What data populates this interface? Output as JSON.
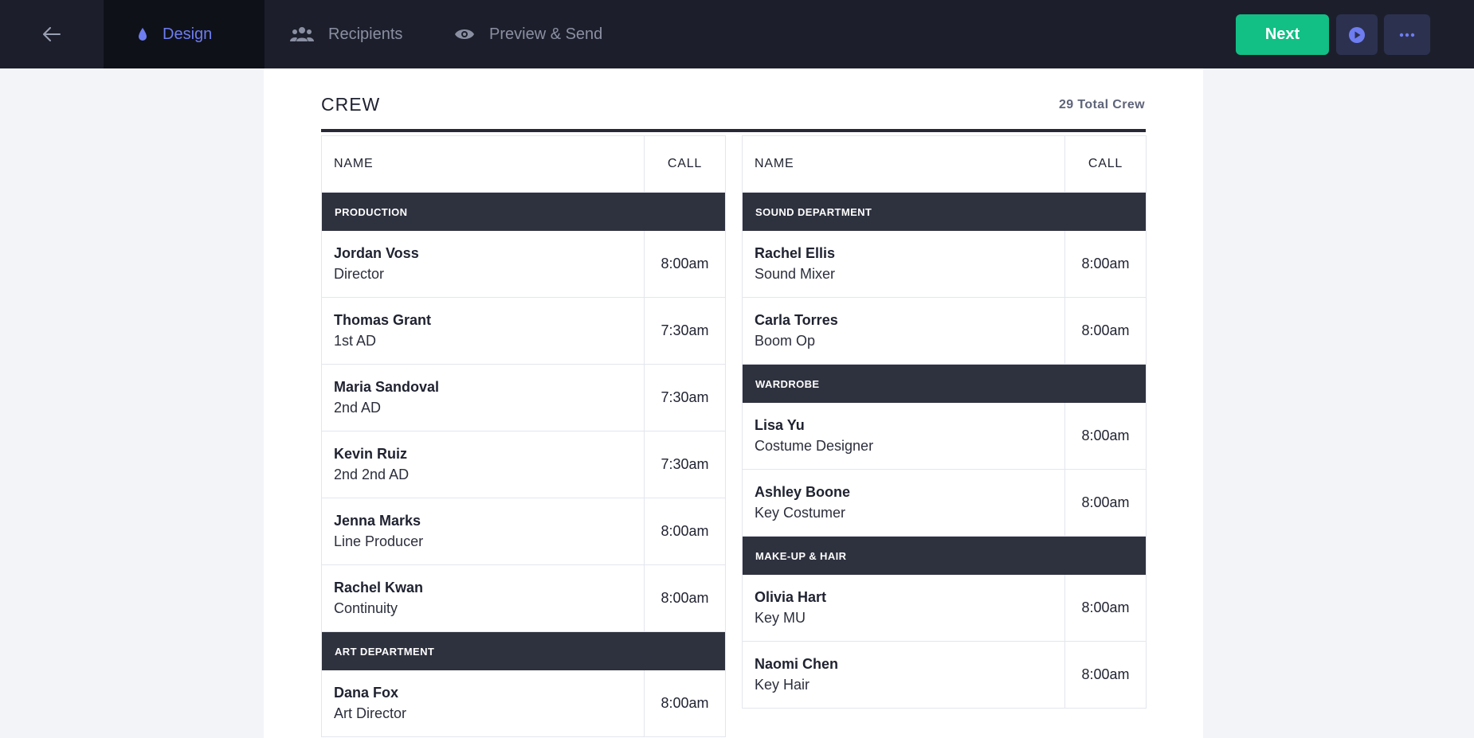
{
  "nav": {
    "back_icon": "arrow-left-icon",
    "tabs": [
      {
        "label": "Design",
        "icon": "droplet-icon",
        "active": true
      },
      {
        "label": "Recipients",
        "icon": "users-icon",
        "active": false
      },
      {
        "label": "Preview & Send",
        "icon": "eye-icon",
        "active": false
      }
    ],
    "next_label": "Next",
    "play_icon": "play-circle-icon",
    "more_icon": "more-horizontal-icon"
  },
  "colors": {
    "topbar": "#1c1f2b",
    "active_tab": "#6e7df0",
    "next": "#12bf85",
    "dept_header": "#2e313e"
  },
  "crew": {
    "title": "CREW",
    "total": "29 Total Crew",
    "col_name": "NAME",
    "col_call": "CALL",
    "left": {
      "production": {
        "dept": "PRODUCTION",
        "people": [
          {
            "name": "Jordan Voss",
            "role": "Director",
            "call": "8:00am"
          },
          {
            "name": "Thomas Grant",
            "role": "1st AD",
            "call": "7:30am"
          },
          {
            "name": "Maria Sandoval",
            "role": "2nd AD",
            "call": "7:30am"
          },
          {
            "name": "Kevin Ruiz",
            "role": "2nd 2nd AD",
            "call": "7:30am"
          },
          {
            "name": "Jenna Marks",
            "role": "Line Producer",
            "call": "8:00am"
          },
          {
            "name": "Rachel Kwan",
            "role": "Continuity",
            "call": "8:00am"
          }
        ]
      },
      "art": {
        "dept": "ART DEPARTMENT",
        "people": [
          {
            "name": "Dana Fox",
            "role": "Art Director",
            "call": "8:00am"
          }
        ]
      }
    },
    "right": {
      "sound": {
        "dept": "SOUND DEPARTMENT",
        "people": [
          {
            "name": "Rachel Ellis",
            "role": "Sound Mixer",
            "call": "8:00am"
          },
          {
            "name": "Carla Torres",
            "role": "Boom Op",
            "call": "8:00am"
          }
        ]
      },
      "wardrobe": {
        "dept": "WARDROBE",
        "people": [
          {
            "name": "Lisa Yu",
            "role": "Costume Designer",
            "call": "8:00am"
          },
          {
            "name": "Ashley Boone",
            "role": "Key Costumer",
            "call": "8:00am"
          }
        ]
      },
      "makeup": {
        "dept": "MAKE-UP & HAIR",
        "people": [
          {
            "name": "Olivia Hart",
            "role": "Key MU",
            "call": "8:00am"
          },
          {
            "name": "Naomi Chen",
            "role": "Key Hair",
            "call": "8:00am"
          }
        ]
      }
    }
  }
}
